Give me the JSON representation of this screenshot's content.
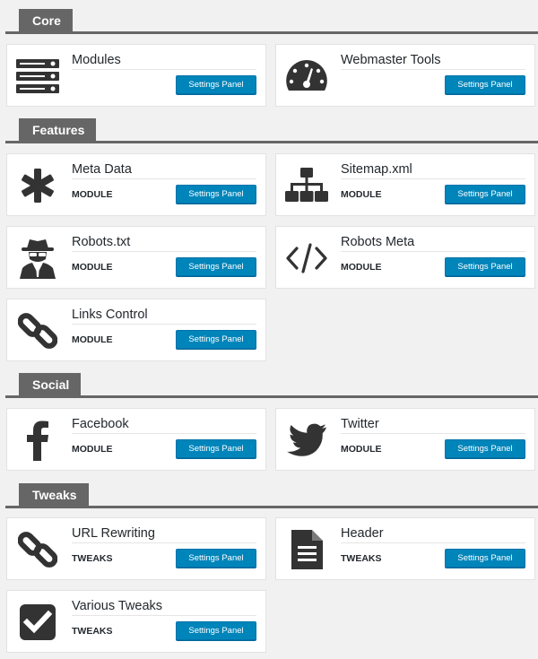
{
  "sections": {
    "core": "Core",
    "features": "Features",
    "social": "Social",
    "tweaks": "Tweaks"
  },
  "button_label": "Settings Panel",
  "cards": {
    "modules": {
      "title": "Modules",
      "tag": ""
    },
    "webmaster": {
      "title": "Webmaster Tools",
      "tag": ""
    },
    "metadata": {
      "title": "Meta Data",
      "tag": "MODULE"
    },
    "sitemap": {
      "title": "Sitemap.xml",
      "tag": "MODULE"
    },
    "robotstxt": {
      "title": "Robots.txt",
      "tag": "MODULE"
    },
    "robotsmeta": {
      "title": "Robots Meta",
      "tag": "MODULE"
    },
    "links": {
      "title": "Links Control",
      "tag": "MODULE"
    },
    "facebook": {
      "title": "Facebook",
      "tag": "MODULE"
    },
    "twitter": {
      "title": "Twitter",
      "tag": "MODULE"
    },
    "urlrewriting": {
      "title": "URL Rewriting",
      "tag": "TWEAKS"
    },
    "header": {
      "title": "Header",
      "tag": "TWEAKS"
    },
    "various": {
      "title": "Various Tweaks",
      "tag": "TWEAKS"
    }
  },
  "colors": {
    "accent": "#0085ba",
    "section_tab": "#666666",
    "icon": "#333333"
  }
}
